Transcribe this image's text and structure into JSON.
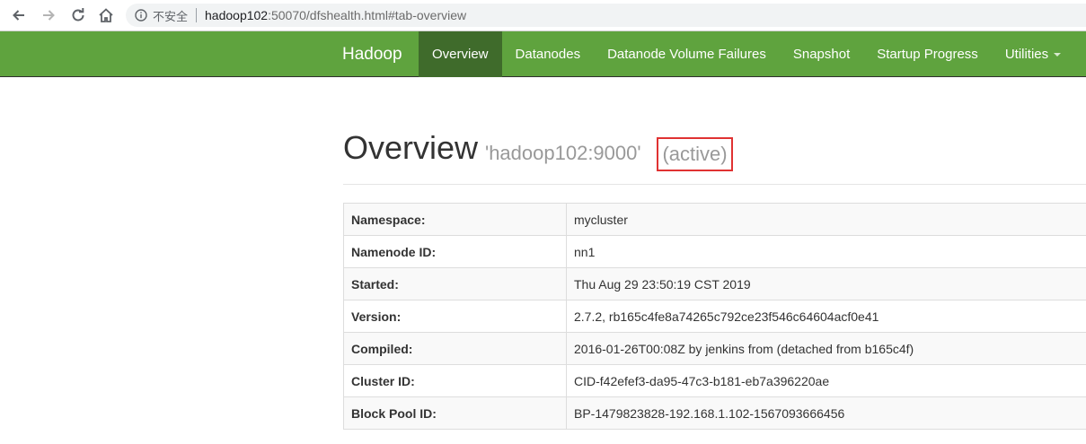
{
  "browser": {
    "insecure_label": "不安全",
    "url_host": "hadoop102",
    "url_rest": ":50070/dfshealth.html#tab-overview"
  },
  "navbar": {
    "brand": "Hadoop",
    "tabs": [
      {
        "label": "Overview",
        "active": true
      },
      {
        "label": "Datanodes"
      },
      {
        "label": "Datanode Volume Failures"
      },
      {
        "label": "Snapshot"
      },
      {
        "label": "Startup Progress"
      },
      {
        "label": "Utilities"
      }
    ],
    "color": "#5fa33e",
    "active_color": "#3f6b2b"
  },
  "header": {
    "title": "Overview",
    "subtitle": "'hadoop102:9000'",
    "status": "(active)",
    "highlight_color": "#e03232"
  },
  "overview_table": {
    "rows": [
      {
        "key": "Namespace:",
        "value": "mycluster"
      },
      {
        "key": "Namenode ID:",
        "value": "nn1"
      },
      {
        "key": "Started:",
        "value": "Thu Aug 29 23:50:19 CST 2019"
      },
      {
        "key": "Version:",
        "value": "2.7.2, rb165c4fe8a74265c792ce23f546c64604acf0e41"
      },
      {
        "key": "Compiled:",
        "value": "2016-01-26T00:08Z by jenkins from (detached from b165c4f)"
      },
      {
        "key": "Cluster ID:",
        "value": "CID-f42efef3-da95-47c3-b181-eb7a396220ae"
      },
      {
        "key": "Block Pool ID:",
        "value": "BP-1479823828-192.168.1.102-1567093666456"
      }
    ]
  }
}
